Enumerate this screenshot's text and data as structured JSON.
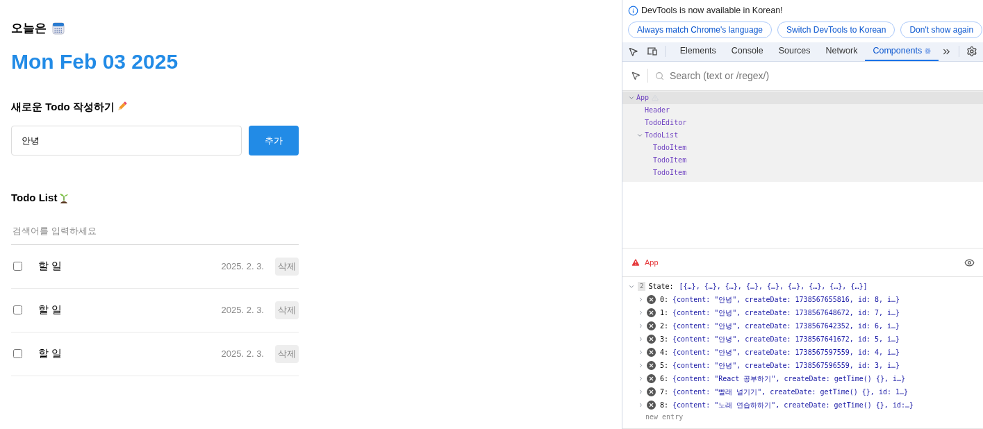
{
  "header": {
    "label": "오늘은",
    "date": "Mon Feb 03 2025"
  },
  "editor": {
    "title": "새로운 Todo 작성하기",
    "input": {
      "value": "안녕"
    },
    "button": "추가"
  },
  "todo_list": {
    "title": "Todo List",
    "search": {
      "placeholder": "검색어를 입력하세요"
    },
    "items": [
      {
        "content": "할 일",
        "date": "2025. 2. 3.",
        "checked": false,
        "button": "삭제"
      },
      {
        "content": "할 일",
        "date": "2025. 2. 3.",
        "checked": false,
        "button": "삭제"
      },
      {
        "content": "할 일",
        "date": "2025. 2. 3.",
        "checked": false,
        "button": "삭제"
      }
    ]
  },
  "devtools": {
    "banner": {
      "message": "DevTools is now available in Korean!",
      "buttons": [
        "Always match Chrome's language",
        "Switch DevTools to Korean",
        "Don't show again"
      ]
    },
    "tabs": [
      {
        "label": "Elements",
        "selected": false
      },
      {
        "label": "Console",
        "selected": false
      },
      {
        "label": "Sources",
        "selected": false
      },
      {
        "label": "Network",
        "selected": false
      },
      {
        "label": "Components",
        "selected": true
      }
    ],
    "search": {
      "placeholder": "Search (text or /regex/)"
    },
    "tree": [
      {
        "label": "App",
        "selected": true,
        "expanded": true,
        "warning": true,
        "children": [
          {
            "label": "Header",
            "selected": false,
            "warning": false
          },
          {
            "label": "TodoEditor",
            "selected": false,
            "warning": false
          },
          {
            "label": "TodoList",
            "selected": false,
            "expanded": true,
            "warning": false,
            "children": [
              {
                "label": "TodoItem",
                "selected": false,
                "warning": false
              },
              {
                "label": "TodoItem",
                "selected": false,
                "warning": false
              },
              {
                "label": "TodoItem",
                "selected": false,
                "warning": false
              }
            ]
          }
        ]
      }
    ],
    "inspector": {
      "component": "App",
      "state": {
        "badge": "2",
        "label": "State:",
        "summary": "[{…}, {…}, {…}, {…}, {…}, {…}, {…}, {…}, {…}]",
        "entries": [
          {
            "key": "0:",
            "value": "{content: \"안녕\", createDate: 1738567655816, id: 8, i…}"
          },
          {
            "key": "1:",
            "value": "{content: \"안녕\", createDate: 1738567648672, id: 7, i…}"
          },
          {
            "key": "2:",
            "value": "{content: \"안녕\", createDate: 1738567642352, id: 6, i…}"
          },
          {
            "key": "3:",
            "value": "{content: \"안녕\", createDate: 1738567641672, id: 5, i…}"
          },
          {
            "key": "4:",
            "value": "{content: \"안녕\", createDate: 1738567597559, id: 4, i…}"
          },
          {
            "key": "5:",
            "value": "{content: \"안녕\", createDate: 1738567596559, id: 3, i…}"
          },
          {
            "key": "6:",
            "value": "{content: \"React 공부하기\", createDate: getTime() {}, i…}"
          },
          {
            "key": "7:",
            "value": "{content: \"빨래 널기기\", createDate: getTime() {}, id: 1…}"
          },
          {
            "key": "8:",
            "value": "{content: \"노래 연습하하기\", createDate: getTime() {}, id:…}"
          }
        ],
        "new_entry": "new entry"
      }
    }
  }
}
